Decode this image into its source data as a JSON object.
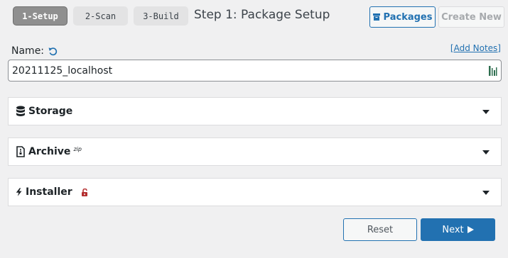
{
  "wizard": {
    "steps": [
      {
        "label": "1-Setup",
        "active": true
      },
      {
        "label": "2-Scan",
        "active": false
      },
      {
        "label": "3-Build",
        "active": false
      }
    ],
    "title": "Step 1: Package Setup"
  },
  "header": {
    "packages_label": "Packages",
    "packages_icon": "archive-box-icon",
    "create_new_label": "Create New"
  },
  "name_field": {
    "label": "Name:",
    "value": "20211125_localhost",
    "add_notes_label": "[Add Notes]",
    "reset_icon": "undo-icon",
    "barcode_icon": "barcode-icon"
  },
  "panels": [
    {
      "title": "Storage",
      "icon": "database-icon"
    },
    {
      "title": "Archive",
      "icon": "file-zip-icon",
      "badge": "zip"
    },
    {
      "title": "Installer",
      "icon": "bolt-icon",
      "status_icon": "unlocked-lock-icon"
    }
  ],
  "footer": {
    "reset_label": "Reset",
    "next_label": "Next",
    "next_icon": "play-arrow-icon"
  },
  "colors": {
    "primary": "#2271b1",
    "lock_red": "#b32d2e",
    "active_step": "#8f8f8f",
    "background": "#f0f0f1"
  }
}
